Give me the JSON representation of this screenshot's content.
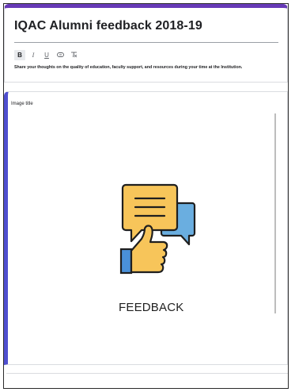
{
  "form": {
    "title": "IQAC Alumni feedback 2018-19",
    "description": "Share your thoughts on the quality of education, faculty support, and resources during your time at the Institution.",
    "toolbar": {
      "bold": "B",
      "italic": "I",
      "underline": "U",
      "link": "⊖",
      "clear": "⨯"
    }
  },
  "image_item": {
    "title": "Image title",
    "image_caption": "FEEDBACK",
    "icons": [
      "speech-bubbles-icon",
      "thumbs-up-icon"
    ],
    "colors": {
      "bubble_front": "#f7c55a",
      "bubble_back": "#6aaee0",
      "thumb": "#f7c55a",
      "cuff": "#4a90d9",
      "outline": "#1f1f1f",
      "accent": "#673ab7",
      "item_border": "#4f4fd0"
    }
  }
}
